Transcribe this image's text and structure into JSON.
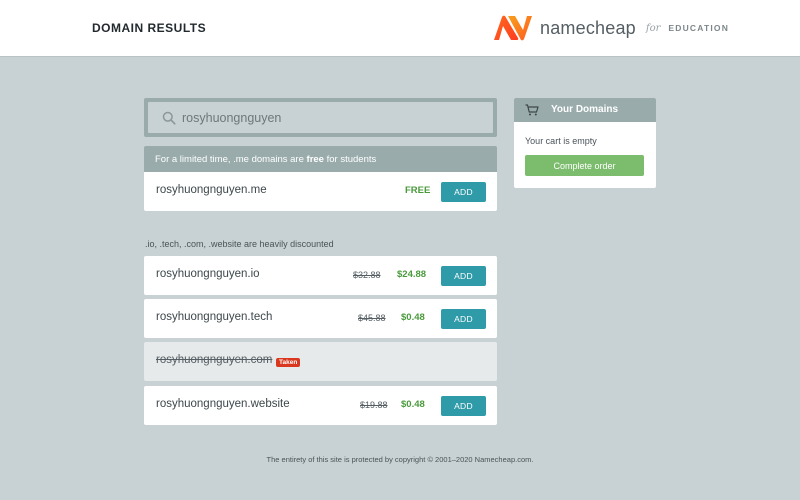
{
  "header": {
    "title": "DOMAIN RESULTS",
    "brand": "namecheap",
    "brand_for": "for",
    "brand_edu": "EDUCATION",
    "brand_colors": [
      "#ff5a1f",
      "#f28c1e"
    ]
  },
  "search": {
    "value": "rosyhuongnguyen",
    "icon": "search-icon"
  },
  "promo": {
    "prefix": "For a limited time, .me domains are ",
    "bold": "free",
    "suffix": " for students",
    "domain": "rosyhuongnguyen.me",
    "price": "FREE",
    "add_label": "ADD"
  },
  "discount_note": ".io, .tech, .com, .website are heavily discounted",
  "domains": [
    {
      "name": "rosyhuongnguyen.io",
      "old_price": "$32.88",
      "new_price": "$24.88",
      "add_label": "ADD"
    },
    {
      "name": "rosyhuongnguyen.tech",
      "old_price": "$45.88",
      "new_price": "$0.48",
      "add_label": "ADD"
    },
    {
      "name": "rosyhuongnguyen.com",
      "badge": "Taken"
    },
    {
      "name": "rosyhuongnguyen.website",
      "old_price": "$19.88",
      "new_price": "$0.48",
      "add_label": "ADD"
    }
  ],
  "cart": {
    "title": "Your Domains",
    "icon": "cart-icon",
    "empty_text": "Your cart is empty",
    "complete_label": "Complete order"
  },
  "footer": "The entirety of this site is protected by copyright © 2001–2020 Namecheap.com.",
  "colors": {
    "accent": "#2f9aa8",
    "price_green": "#4a9a3c",
    "complete_green": "#7bbd6d",
    "taken_red": "#d9381e",
    "panel_gray": "#9aabab",
    "background": "#c8d1d3"
  }
}
